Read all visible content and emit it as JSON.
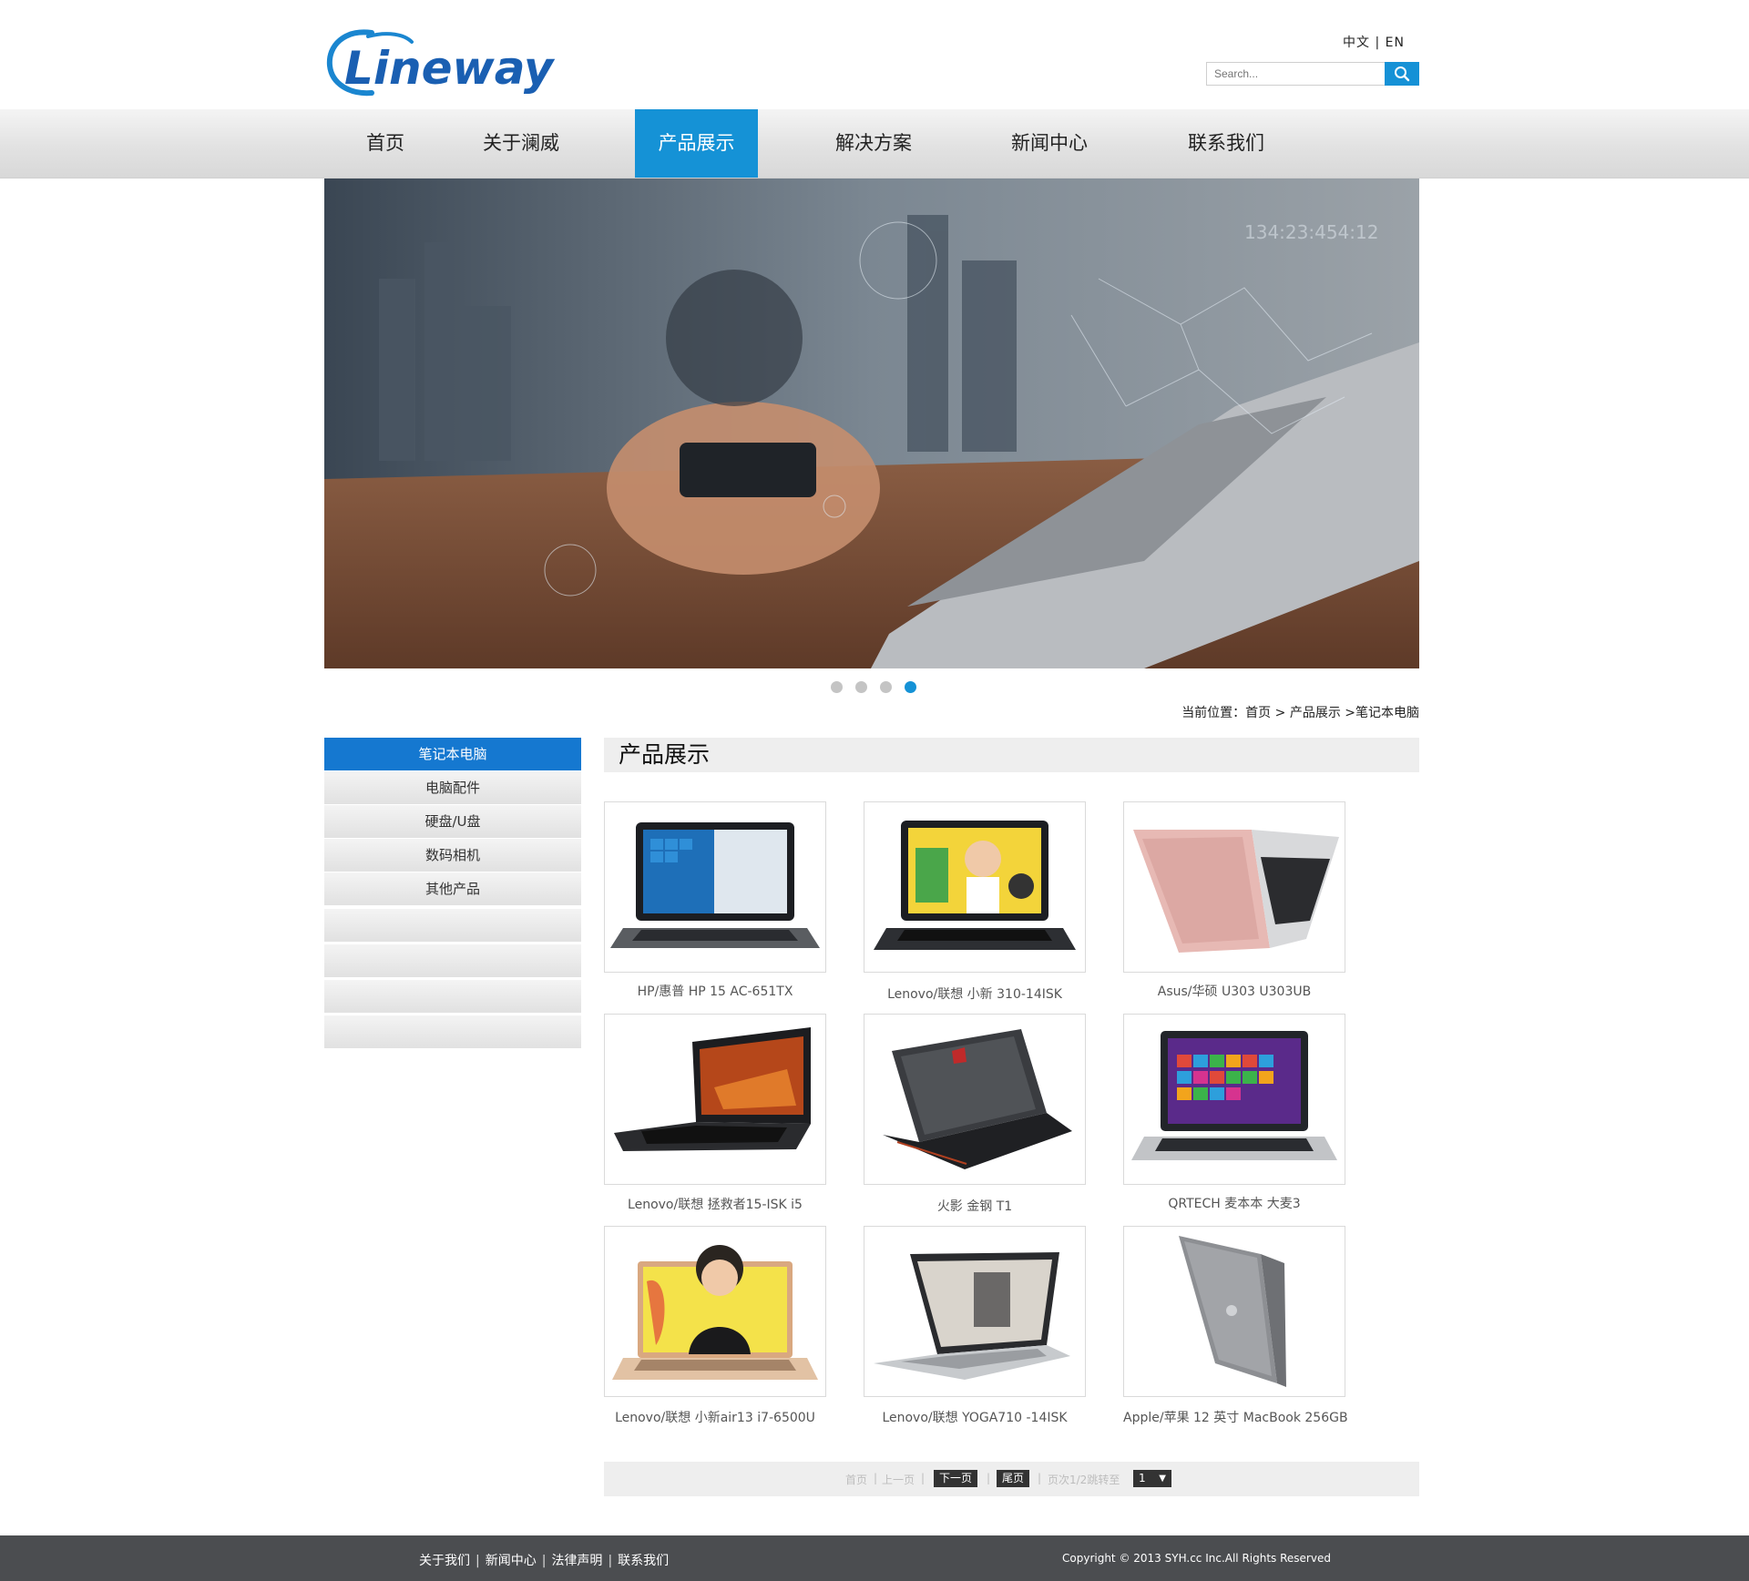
{
  "header": {
    "logo_text": "Lineway",
    "language": "中文 | EN",
    "search": {
      "placeholder": "Search..."
    }
  },
  "nav": {
    "items": [
      {
        "label": "首页"
      },
      {
        "label": "关于澜威"
      },
      {
        "label": "产品展示",
        "active": true
      },
      {
        "label": "解决方案"
      },
      {
        "label": "新闻中心"
      },
      {
        "label": "联系我们"
      }
    ]
  },
  "banner": {
    "overlay_text": "134:23:454:12",
    "slides": 4,
    "active_slide": 4
  },
  "breadcrumb": {
    "text": "当前位置：首页 > 产品展示 >笔记本电脑"
  },
  "sidebar": {
    "items": [
      {
        "label": "笔记本电脑",
        "active": true
      },
      {
        "label": "电脑配件"
      },
      {
        "label": "硬盘/U盘"
      },
      {
        "label": "数码相机"
      },
      {
        "label": "其他产品"
      },
      {
        "label": ""
      },
      {
        "label": ""
      },
      {
        "label": ""
      },
      {
        "label": ""
      }
    ]
  },
  "content": {
    "title": "产品展示",
    "products": [
      {
        "name": "HP/惠普 HP 15 AC-651TX",
        "icon": "laptop-windows-image"
      },
      {
        "name": "Lenovo/联想 小新 310-14ISK",
        "icon": "laptop-cartoon-image"
      },
      {
        "name": "Asus/华硕 U303 U303UB",
        "icon": "laptop-rosegold-image"
      },
      {
        "name": "Lenovo/联想 拯救者15-ISK i5",
        "icon": "laptop-gaming-image"
      },
      {
        "name": "火影 金钢 T1",
        "icon": "laptop-black-lid-image"
      },
      {
        "name": "QRTECH 麦本本 大麦3",
        "icon": "laptop-metro-image"
      },
      {
        "name": "Lenovo/联想 小新air13 i7-6500U",
        "icon": "laptop-person-image"
      },
      {
        "name": "Lenovo/联想 YOGA710 -14ISK",
        "icon": "laptop-yoga-image"
      },
      {
        "name": "Apple/苹果 12 英寸 MacBook 256GB",
        "icon": "laptop-macbook-image"
      }
    ]
  },
  "pagination": {
    "first": "首页",
    "prev": "上一页",
    "next": "下一页",
    "last": "尾页",
    "info": "页次1/2跳转至",
    "selected_page": "1",
    "sep": "|"
  },
  "footer": {
    "links": [
      "关于我们",
      "新闻中心",
      "法律声明",
      "联系我们"
    ],
    "copyright": "Copyright © 2013 SYH.cc Inc.All Rights Reserved"
  },
  "colors": {
    "accent": "#1592d6",
    "sidebar_active": "#1578d0",
    "footer_bg": "#4b4d50"
  }
}
